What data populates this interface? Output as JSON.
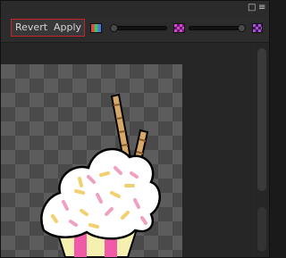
{
  "toolbar": {
    "revert_label": "Revert",
    "apply_label": "Apply"
  },
  "icons": {
    "maximize": "maximize-icon",
    "menu": "menu-icon",
    "rgb_channels": "rgb-channels-icon",
    "alpha_checker": "alpha-checker-icon"
  },
  "colors": {
    "highlight_border": "#c8232c",
    "panel_bg": "#282828",
    "checker_light": "#5c5c5c",
    "checker_dark": "#4a4a4a"
  }
}
